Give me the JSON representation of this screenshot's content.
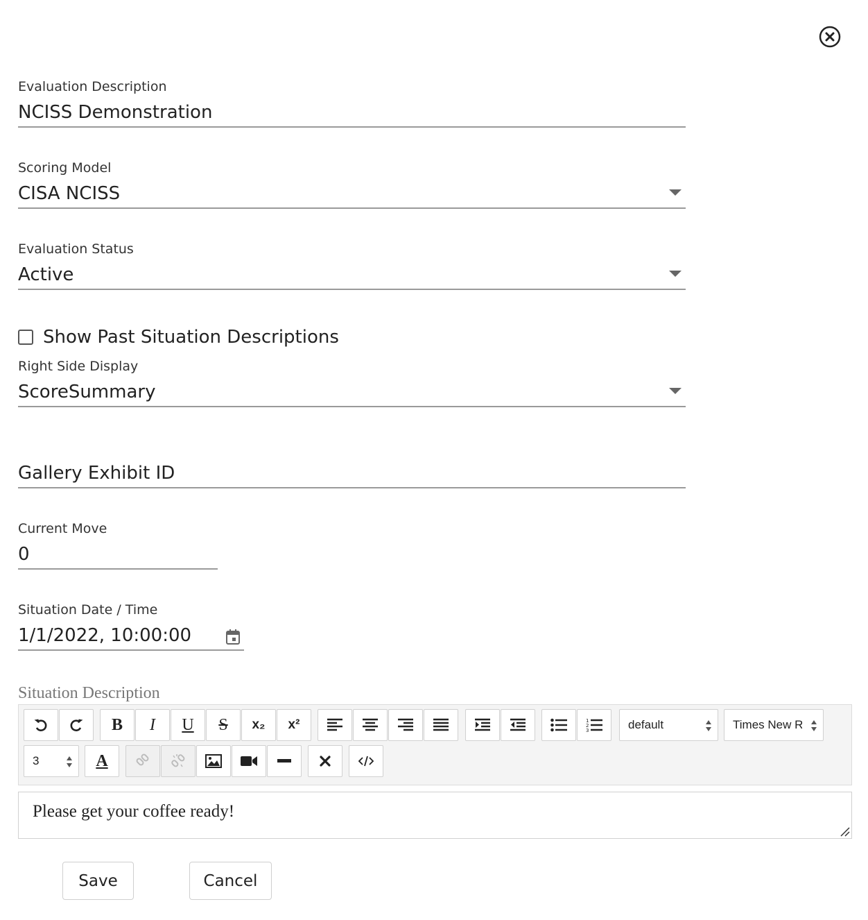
{
  "close": {
    "icon": "close-circle-icon"
  },
  "form": {
    "evaluation_description": {
      "label": "Evaluation Description",
      "value": "NCISS Demonstration"
    },
    "scoring_model": {
      "label": "Scoring Model",
      "value": "CISA NCISS"
    },
    "evaluation_status": {
      "label": "Evaluation Status",
      "value": "Active"
    },
    "show_past": {
      "label": "Show Past Situation Descriptions",
      "checked": false
    },
    "right_side_display": {
      "label": "Right Side Display",
      "value": "ScoreSummary"
    },
    "gallery_exhibit": {
      "placeholder": "Gallery Exhibit ID",
      "value": ""
    },
    "current_move": {
      "label": "Current Move",
      "value": "0"
    },
    "situation_datetime": {
      "label": "Situation Date / Time",
      "value": "1/1/2022, 10:00:00"
    }
  },
  "editor": {
    "label": "Situation Description",
    "toolbar": {
      "bold": "B",
      "italic": "I",
      "underline": "U",
      "strike": "S",
      "subscript": "x₂",
      "superscript": "x²",
      "heading_select": "default",
      "font_select": "Times New Roman",
      "size_select": "3",
      "text_color": "A"
    },
    "content": "Please get your coffee ready!"
  },
  "actions": {
    "save": "Save",
    "cancel": "Cancel"
  }
}
